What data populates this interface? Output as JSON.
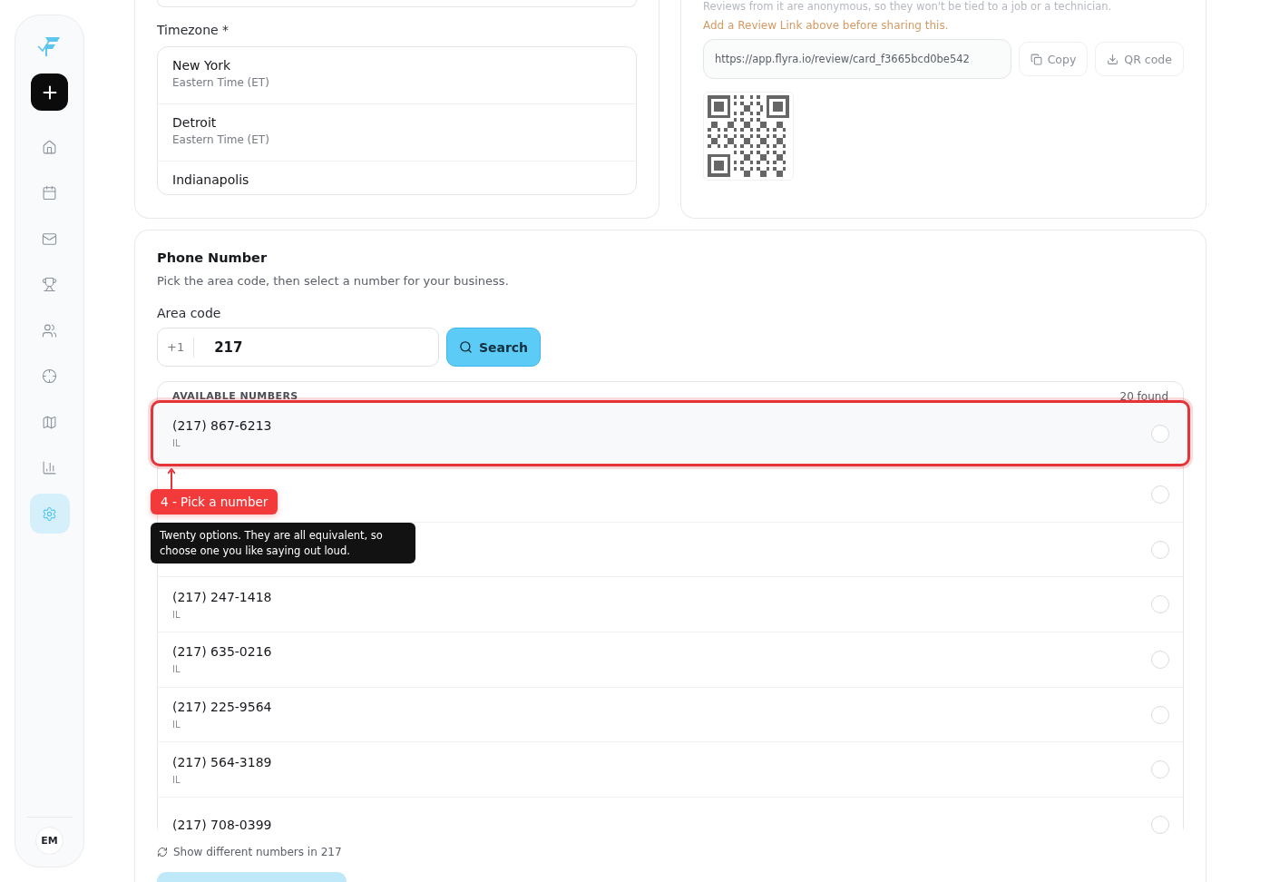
{
  "sidebar": {
    "items": [
      {
        "kind": "home",
        "selected": false
      },
      {
        "kind": "calendar",
        "selected": false
      },
      {
        "kind": "mail",
        "selected": false
      },
      {
        "kind": "trophy",
        "selected": false
      },
      {
        "kind": "users",
        "selected": false
      },
      {
        "kind": "target",
        "selected": false
      },
      {
        "kind": "map",
        "selected": false
      },
      {
        "kind": "chart",
        "selected": false
      },
      {
        "kind": "settings",
        "selected": true
      }
    ],
    "avatar": "EM"
  },
  "timezone": {
    "label": "Timezone *",
    "options": [
      {
        "city": "New York",
        "zone": "Eastern Time (ET)"
      },
      {
        "city": "Detroit",
        "zone": "Eastern Time (ET)"
      },
      {
        "city": "Indianapolis"
      }
    ]
  },
  "review": {
    "note": "Reviews from it are anonymous, so they won't be tied to a job or a technician.",
    "warning": "Add a Review Link above before sharing this.",
    "link": "https://app.flyra.io/review/card_f3665bcd0be542",
    "buttons": [
      {
        "kind": "copy",
        "label": "Copy"
      },
      {
        "kind": "download",
        "label": "QR code"
      }
    ]
  },
  "phone": {
    "title": "Phone Number",
    "description": "Pick the area code, then select a number for your business.",
    "area_code_label": "Area code",
    "country_code": "+1",
    "area_code": "217",
    "search_button": "Search",
    "list_header": "AVAILABLE NUMBERS",
    "count": "20 found",
    "numbers": [
      {
        "number": "(217) 867-6213",
        "region": "IL",
        "selected": false,
        "highlighted": true
      },
      {
        "selected": false,
        "highlighted": false
      },
      {
        "selected": false,
        "highlighted": false
      },
      {
        "number": "(217) 247-1418",
        "region": "IL",
        "selected": false,
        "highlighted": false
      },
      {
        "number": "(217) 635-0216",
        "region": "IL",
        "selected": false,
        "highlighted": false
      },
      {
        "number": "(217) 225-9564",
        "region": "IL",
        "selected": false,
        "highlighted": false
      },
      {
        "number": "(217) 564-3189",
        "region": "IL",
        "selected": false,
        "highlighted": false
      },
      {
        "number": "(217) 708-0399",
        "selected": false,
        "highlighted": false
      }
    ],
    "refresh_link": "Show different numbers in 217"
  },
  "tour": {
    "step": "4 - Pick a number",
    "text": "Twenty options. They are all equivalent, so choose one you like saying out loud."
  }
}
